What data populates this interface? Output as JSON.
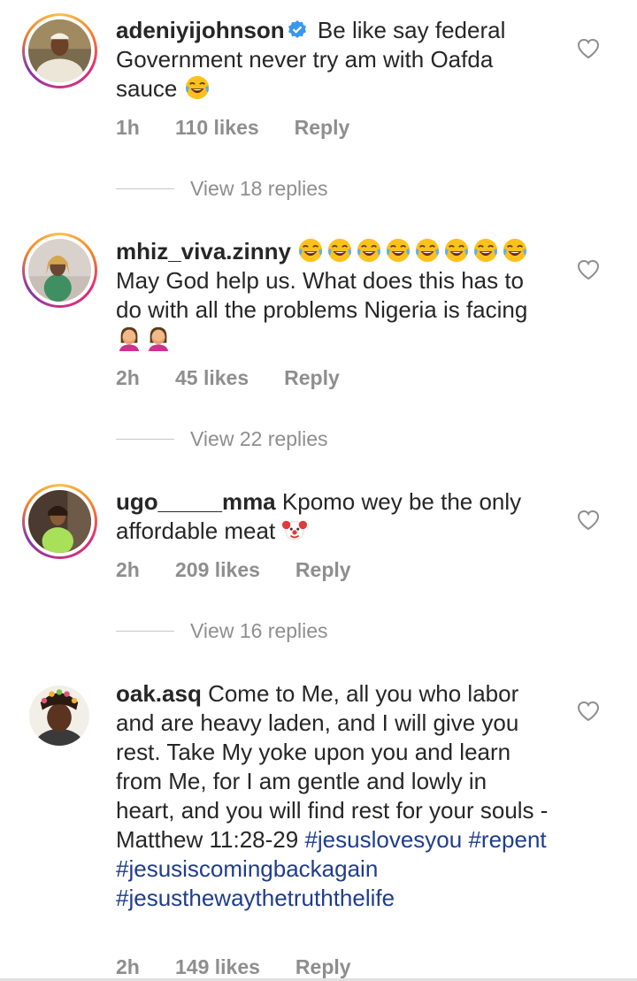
{
  "comments": [
    {
      "username": "adeniyijohnson",
      "verified": true,
      "text": "Be like say federal Government never try am with Oafda sauce",
      "time": "1h",
      "likes": "110 likes",
      "reply": "Reply",
      "view_replies": "View 18 replies"
    },
    {
      "username": "mhiz_viva.zinny",
      "text": "May God help us. What does this has to do with all the problems Nigeria is facing",
      "time": "2h",
      "likes": "45 likes",
      "reply": "Reply",
      "view_replies": "View 22 replies"
    },
    {
      "username": "ugo_____mma",
      "text": "Kpomo wey be the only affordable meat",
      "time": "2h",
      "likes": "209 likes",
      "reply": "Reply",
      "view_replies": "View 16 replies"
    },
    {
      "username": "oak.asq",
      "text": "Come to Me, all you who labor and are heavy laden, and I will give you rest. Take My yoke upon you and learn from Me, for I am gentle and lowly in heart, and you will find rest for your souls - Matthew 11:28-29",
      "hashtags": [
        "#jesuslovesyou",
        "#repent",
        "#jesusiscomingbackagain",
        "#jesusthewaythetruththelife"
      ],
      "time": "2h",
      "likes": "149 likes",
      "reply": "Reply"
    }
  ],
  "icons": {
    "heart": "heart-outline-icon",
    "verified": "verified-badge-icon",
    "laugh_emoji": "tears-of-joy-emoji",
    "facepalm_emoji": "facepalm-emoji",
    "clown_emoji": "clown-face-emoji"
  },
  "colors": {
    "text": "#262626",
    "secondary": "#8e8e8e",
    "hashtag": "#1e3d8c",
    "verified": "#3897f0"
  }
}
